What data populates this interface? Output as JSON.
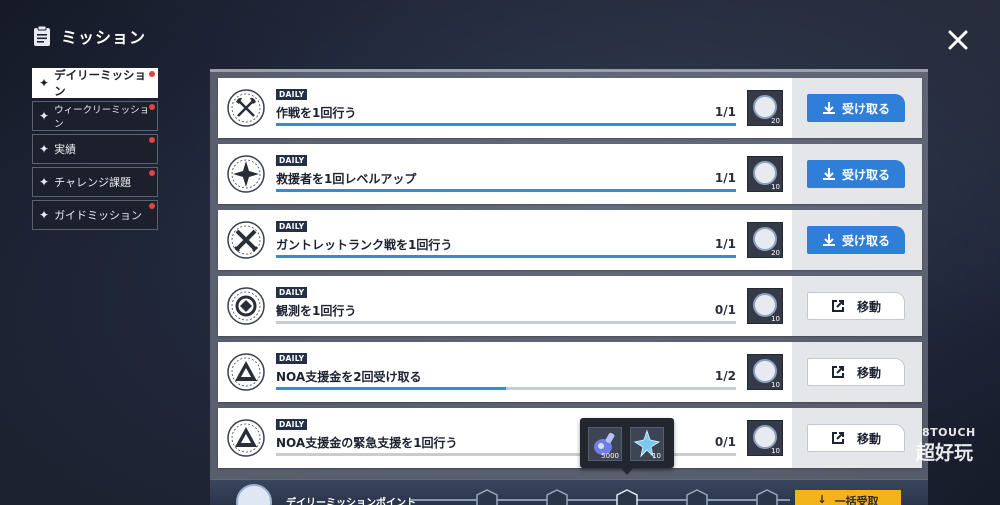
{
  "header": {
    "title": "ミッション"
  },
  "sidebar": {
    "items": [
      {
        "label": "デイリーミッション",
        "active": true,
        "badge": true
      },
      {
        "label": "ウィークリーミッション",
        "active": false,
        "badge": true
      },
      {
        "label": "実績",
        "active": false,
        "badge": true
      },
      {
        "label": "チャレンジ課題",
        "active": false,
        "badge": true
      },
      {
        "label": "ガイドミッション",
        "active": false,
        "badge": true
      }
    ]
  },
  "missions": [
    {
      "tag": "DAILY",
      "title": "作戦を1回行う",
      "progress": "1/1",
      "fill": 1.0,
      "reward_qty": "20",
      "action": "受け取る",
      "action_type": "claim",
      "icon": "crossed-axes-icon"
    },
    {
      "tag": "DAILY",
      "title": "救援者を1回レベルアップ",
      "progress": "1/1",
      "fill": 1.0,
      "reward_qty": "10",
      "action": "受け取る",
      "action_type": "claim",
      "icon": "compass-star-icon"
    },
    {
      "tag": "DAILY",
      "title": "ガントレットランク戦を1回行う",
      "progress": "1/1",
      "fill": 1.0,
      "reward_qty": "20",
      "action": "受け取る",
      "action_type": "claim",
      "icon": "crossed-swords-icon"
    },
    {
      "tag": "DAILY",
      "title": "観測を1回行う",
      "progress": "0/1",
      "fill": 0.0,
      "reward_qty": "10",
      "action": "移動",
      "action_type": "move",
      "icon": "observation-icon"
    },
    {
      "tag": "DAILY",
      "title": "NOA支援金を2回受け取る",
      "progress": "1/2",
      "fill": 0.5,
      "reward_qty": "10",
      "action": "移動",
      "action_type": "move",
      "icon": "noa-triangle-icon"
    },
    {
      "tag": "DAILY",
      "title": "NOA支援金の緊急支援を1回行う",
      "progress": "0/1",
      "fill": 0.0,
      "reward_qty": "10",
      "action": "移動",
      "action_type": "move",
      "icon": "noa-triangle-icon"
    }
  ],
  "tooltip": {
    "items": [
      {
        "icon": "crystal-vial-icon",
        "qty": "5000"
      },
      {
        "icon": "blue-crystal-icon",
        "qty": "10"
      }
    ]
  },
  "bottom": {
    "label": "デイリーミッションポイント",
    "button": "一括受取"
  },
  "watermark": {
    "line1": "8TOUCH",
    "line2": "超好玩"
  },
  "colors": {
    "accent": "#2f7fd8",
    "progress": "#2e8fd6",
    "gold": "#f2b418",
    "badge": "#e0453a"
  }
}
